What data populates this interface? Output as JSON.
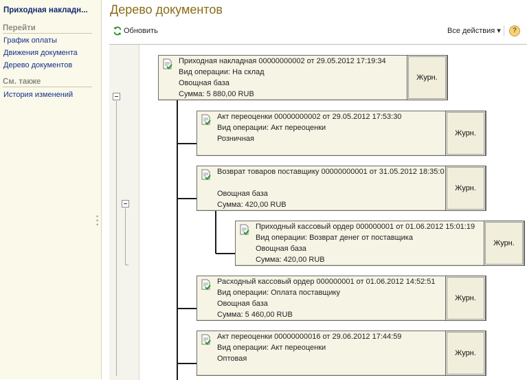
{
  "sidebar": {
    "doc_title": "Приходная накладн...",
    "goto_header": "Перейти",
    "goto_items": [
      {
        "label": "График оплаты"
      },
      {
        "label": "Движения документа"
      },
      {
        "label": "Дерево документов"
      }
    ],
    "see_also_header": "См. также",
    "see_also_items": [
      {
        "label": "История изменений"
      }
    ]
  },
  "main": {
    "title": "Дерево документов",
    "toolbar": {
      "refresh_label": "Обновить",
      "all_actions_label": "Все действия ▾",
      "help_label": "?"
    }
  },
  "tree": {
    "journal_label": "Журн.",
    "nodes": [
      {
        "lines": [
          "Приходная накладная 00000000002 от 29.05.2012 17:19:34",
          "Вид операции: На склад",
          "Овощная база",
          "Сумма: 5 880,00 RUB"
        ]
      },
      {
        "lines": [
          "Акт переоценки 00000000002 от 29.05.2012 17:53:30",
          "Вид операции: Акт переоценки",
          "Розничная",
          ""
        ]
      },
      {
        "lines": [
          "Возврат товаров поставщику 00000000001 от 31.05.2012 18:35:0",
          "",
          "Овощная база",
          "Сумма: 420,00 RUB"
        ]
      },
      {
        "lines": [
          "Приходный кассовый ордер 000000001 от 01.06.2012 15:01:19",
          "Вид операции: Возврат денег от поставщика",
          "Овощная база",
          "Сумма: 420,00 RUB"
        ]
      },
      {
        "lines": [
          "Расходный кассовый ордер 000000001 от 01.06.2012 14:52:51",
          "Вид операции: Оплата поставщику",
          "Овощная база",
          "Сумма: 5 460,00 RUB"
        ]
      },
      {
        "lines": [
          "Акт переоценки 00000000016 от 29.06.2012 17:44:59",
          "Вид операции: Акт переоценки",
          "Оптовая",
          ""
        ]
      }
    ]
  }
}
